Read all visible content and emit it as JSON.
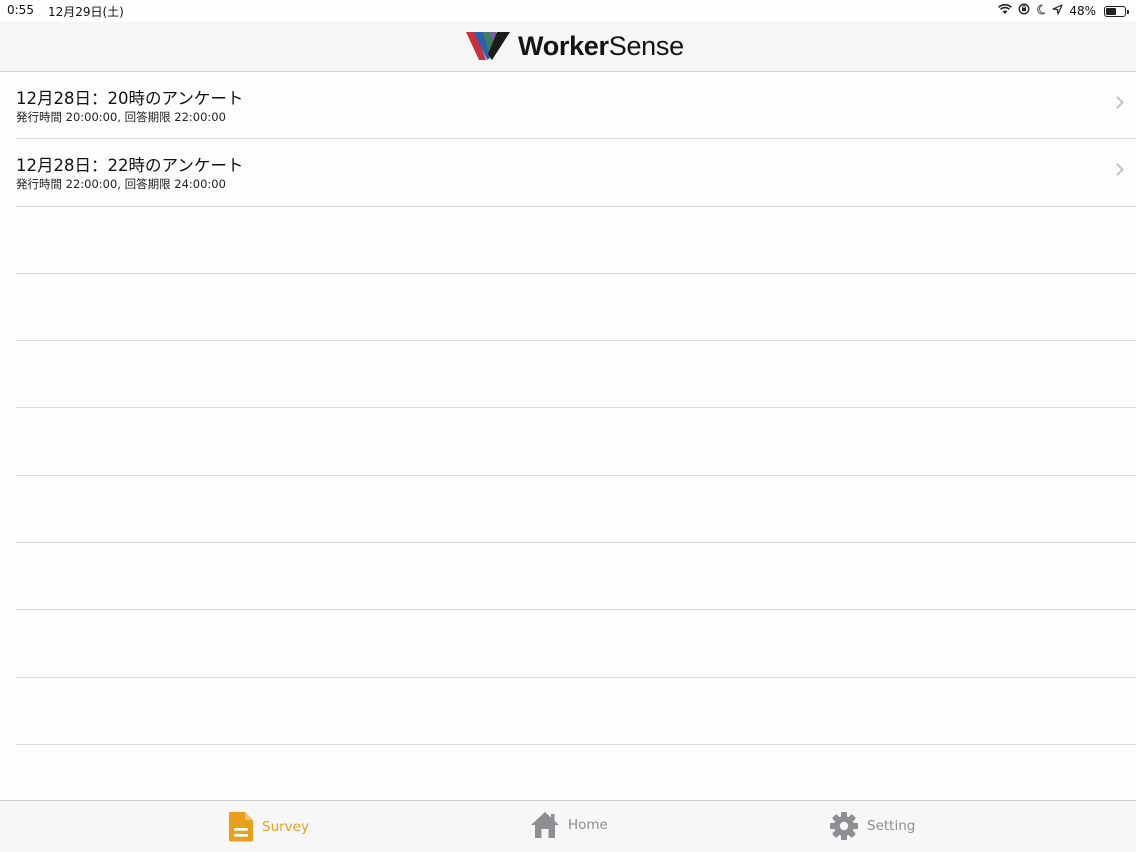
{
  "status_bar": {
    "time": "0:55",
    "date": "12月29日(土)",
    "battery_text": "48%",
    "battery_level": 0.48,
    "icons": [
      "wifi-icon",
      "orientation-lock-icon",
      "moon-icon",
      "location-arrow-icon",
      "battery-icon"
    ]
  },
  "nav": {
    "brand_bold": "Worker",
    "brand_light": "Sense"
  },
  "surveys": [
    {
      "title": "12月28日：20時のアンケート",
      "subtitle": "発行時間 20:00:00, 回答期限 22:00:00"
    },
    {
      "title": "12月28日：22時のアンケート",
      "subtitle": "発行時間 22:00:00, 回答期限 24:00:00"
    }
  ],
  "tabs": [
    {
      "label": "Survey",
      "icon": "document-icon",
      "active": true
    },
    {
      "label": "Home",
      "icon": "house-icon",
      "active": false
    },
    {
      "label": "Setting",
      "icon": "gear-icon",
      "active": false
    }
  ],
  "colors": {
    "accent": "#e8a01e",
    "inactive_tab": "#8e8e93",
    "separator": "#dcdcde"
  }
}
